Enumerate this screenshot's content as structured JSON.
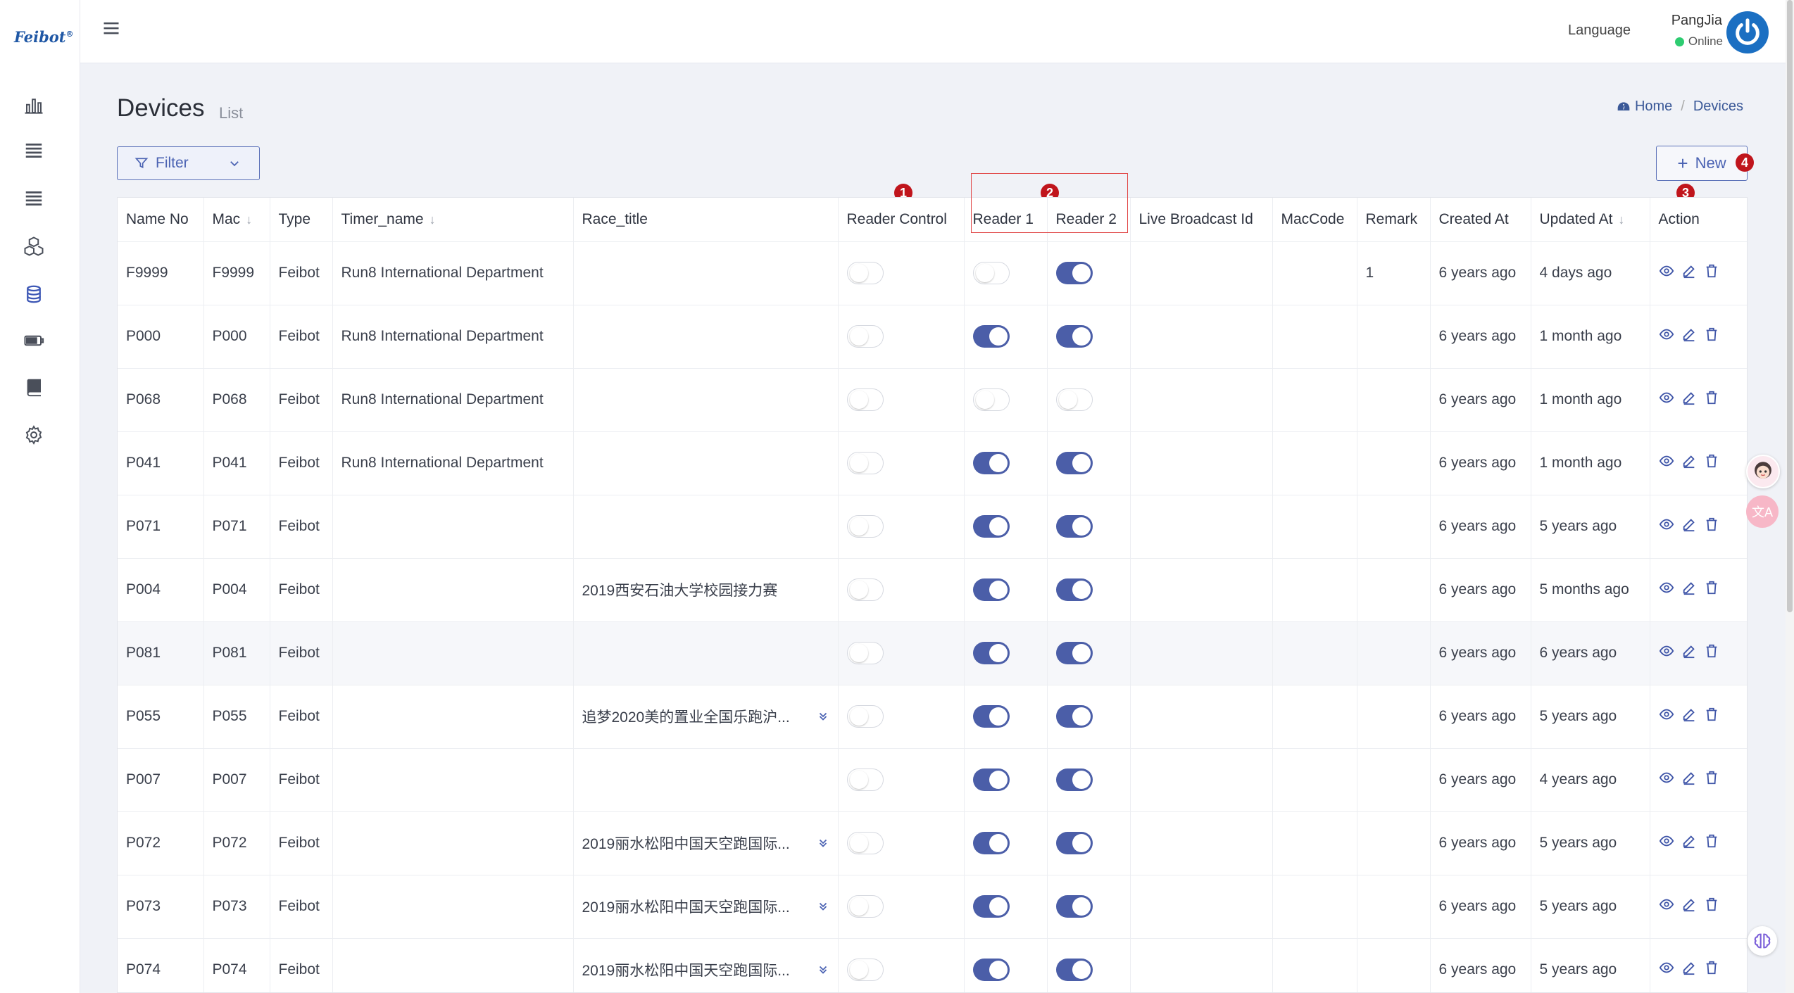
{
  "app": {
    "logo": "Feibot",
    "logo_mark": "®"
  },
  "header": {
    "language_label": "Language",
    "user_name": "PangJia",
    "user_status": "Online"
  },
  "page": {
    "title": "Devices",
    "subtitle": "List"
  },
  "breadcrumb": {
    "home": "Home",
    "current": "Devices"
  },
  "toolbar": {
    "filter_label": "Filter",
    "new_label": "New"
  },
  "markers": [
    "1",
    "2",
    "3",
    "4"
  ],
  "table": {
    "columns": [
      "Name No",
      "Mac",
      "Type",
      "Timer_name",
      "Race_title",
      "Reader Control",
      "Reader 1",
      "Reader 2",
      "Live Broadcast Id",
      "MacCode",
      "Remark",
      "Created At",
      "Updated At",
      "Action"
    ],
    "rows": [
      {
        "name_no": "F9999",
        "mac": "F9999",
        "type": "Feibot",
        "timer_name": "Run8 International Department",
        "race_title": "",
        "expandable": false,
        "reader_control": false,
        "reader1": false,
        "reader2": true,
        "live_broadcast_id": "",
        "maccode": "",
        "remark": "1",
        "created_at": "6 years ago",
        "updated_at": "4 days ago"
      },
      {
        "name_no": "P000",
        "mac": "P000",
        "type": "Feibot",
        "timer_name": "Run8 International Department",
        "race_title": "",
        "expandable": false,
        "reader_control": false,
        "reader1": true,
        "reader2": true,
        "live_broadcast_id": "",
        "maccode": "",
        "remark": "",
        "created_at": "6 years ago",
        "updated_at": "1 month ago"
      },
      {
        "name_no": "P068",
        "mac": "P068",
        "type": "Feibot",
        "timer_name": "Run8 International Department",
        "race_title": "",
        "expandable": false,
        "reader_control": false,
        "reader1": false,
        "reader2": false,
        "live_broadcast_id": "",
        "maccode": "",
        "remark": "",
        "created_at": "6 years ago",
        "updated_at": "1 month ago"
      },
      {
        "name_no": "P041",
        "mac": "P041",
        "type": "Feibot",
        "timer_name": "Run8 International Department",
        "race_title": "",
        "expandable": false,
        "reader_control": false,
        "reader1": true,
        "reader2": true,
        "live_broadcast_id": "",
        "maccode": "",
        "remark": "",
        "created_at": "6 years ago",
        "updated_at": "1 month ago"
      },
      {
        "name_no": "P071",
        "mac": "P071",
        "type": "Feibot",
        "timer_name": "",
        "race_title": "",
        "expandable": false,
        "reader_control": false,
        "reader1": true,
        "reader2": true,
        "live_broadcast_id": "",
        "maccode": "",
        "remark": "",
        "created_at": "6 years ago",
        "updated_at": "5 years ago"
      },
      {
        "name_no": "P004",
        "mac": "P004",
        "type": "Feibot",
        "timer_name": "",
        "race_title": "2019西安石油大学校园接力赛",
        "expandable": false,
        "reader_control": false,
        "reader1": true,
        "reader2": true,
        "live_broadcast_id": "",
        "maccode": "",
        "remark": "",
        "created_at": "6 years ago",
        "updated_at": "5 months ago"
      },
      {
        "name_no": "P081",
        "mac": "P081",
        "type": "Feibot",
        "timer_name": "",
        "race_title": "",
        "expandable": false,
        "reader_control": false,
        "reader1": true,
        "reader2": true,
        "live_broadcast_id": "",
        "maccode": "",
        "remark": "",
        "created_at": "6 years ago",
        "updated_at": "6 years ago"
      },
      {
        "name_no": "P055",
        "mac": "P055",
        "type": "Feibot",
        "timer_name": "",
        "race_title": "追梦2020美的置业全国乐跑沪...",
        "expandable": true,
        "reader_control": false,
        "reader1": true,
        "reader2": true,
        "live_broadcast_id": "",
        "maccode": "",
        "remark": "",
        "created_at": "6 years ago",
        "updated_at": "5 years ago"
      },
      {
        "name_no": "P007",
        "mac": "P007",
        "type": "Feibot",
        "timer_name": "",
        "race_title": "",
        "expandable": false,
        "reader_control": false,
        "reader1": true,
        "reader2": true,
        "live_broadcast_id": "",
        "maccode": "",
        "remark": "",
        "created_at": "6 years ago",
        "updated_at": "4 years ago"
      },
      {
        "name_no": "P072",
        "mac": "P072",
        "type": "Feibot",
        "timer_name": "",
        "race_title": "2019丽水松阳中国天空跑国际...",
        "expandable": true,
        "reader_control": false,
        "reader1": true,
        "reader2": true,
        "live_broadcast_id": "",
        "maccode": "",
        "remark": "",
        "created_at": "6 years ago",
        "updated_at": "5 years ago"
      },
      {
        "name_no": "P073",
        "mac": "P073",
        "type": "Feibot",
        "timer_name": "",
        "race_title": "2019丽水松阳中国天空跑国际...",
        "expandable": true,
        "reader_control": false,
        "reader1": true,
        "reader2": true,
        "live_broadcast_id": "",
        "maccode": "",
        "remark": "",
        "created_at": "6 years ago",
        "updated_at": "5 years ago"
      },
      {
        "name_no": "P074",
        "mac": "P074",
        "type": "Feibot",
        "timer_name": "",
        "race_title": "2019丽水松阳中国天空跑国际...",
        "expandable": true,
        "reader_control": false,
        "reader1": true,
        "reader2": true,
        "live_broadcast_id": "",
        "maccode": "",
        "remark": "",
        "created_at": "6 years ago",
        "updated_at": "5 years ago"
      }
    ]
  },
  "sidebar": {
    "icons": [
      "bar-chart-icon",
      "list-icon",
      "list-icon",
      "cubes-icon",
      "database-icon",
      "battery-icon",
      "book-icon",
      "gear-icon"
    ]
  },
  "colors": {
    "accent": "#4b5ea8",
    "brand": "#1f57a5",
    "marker": "#c0151c",
    "online": "#2ecc71"
  }
}
